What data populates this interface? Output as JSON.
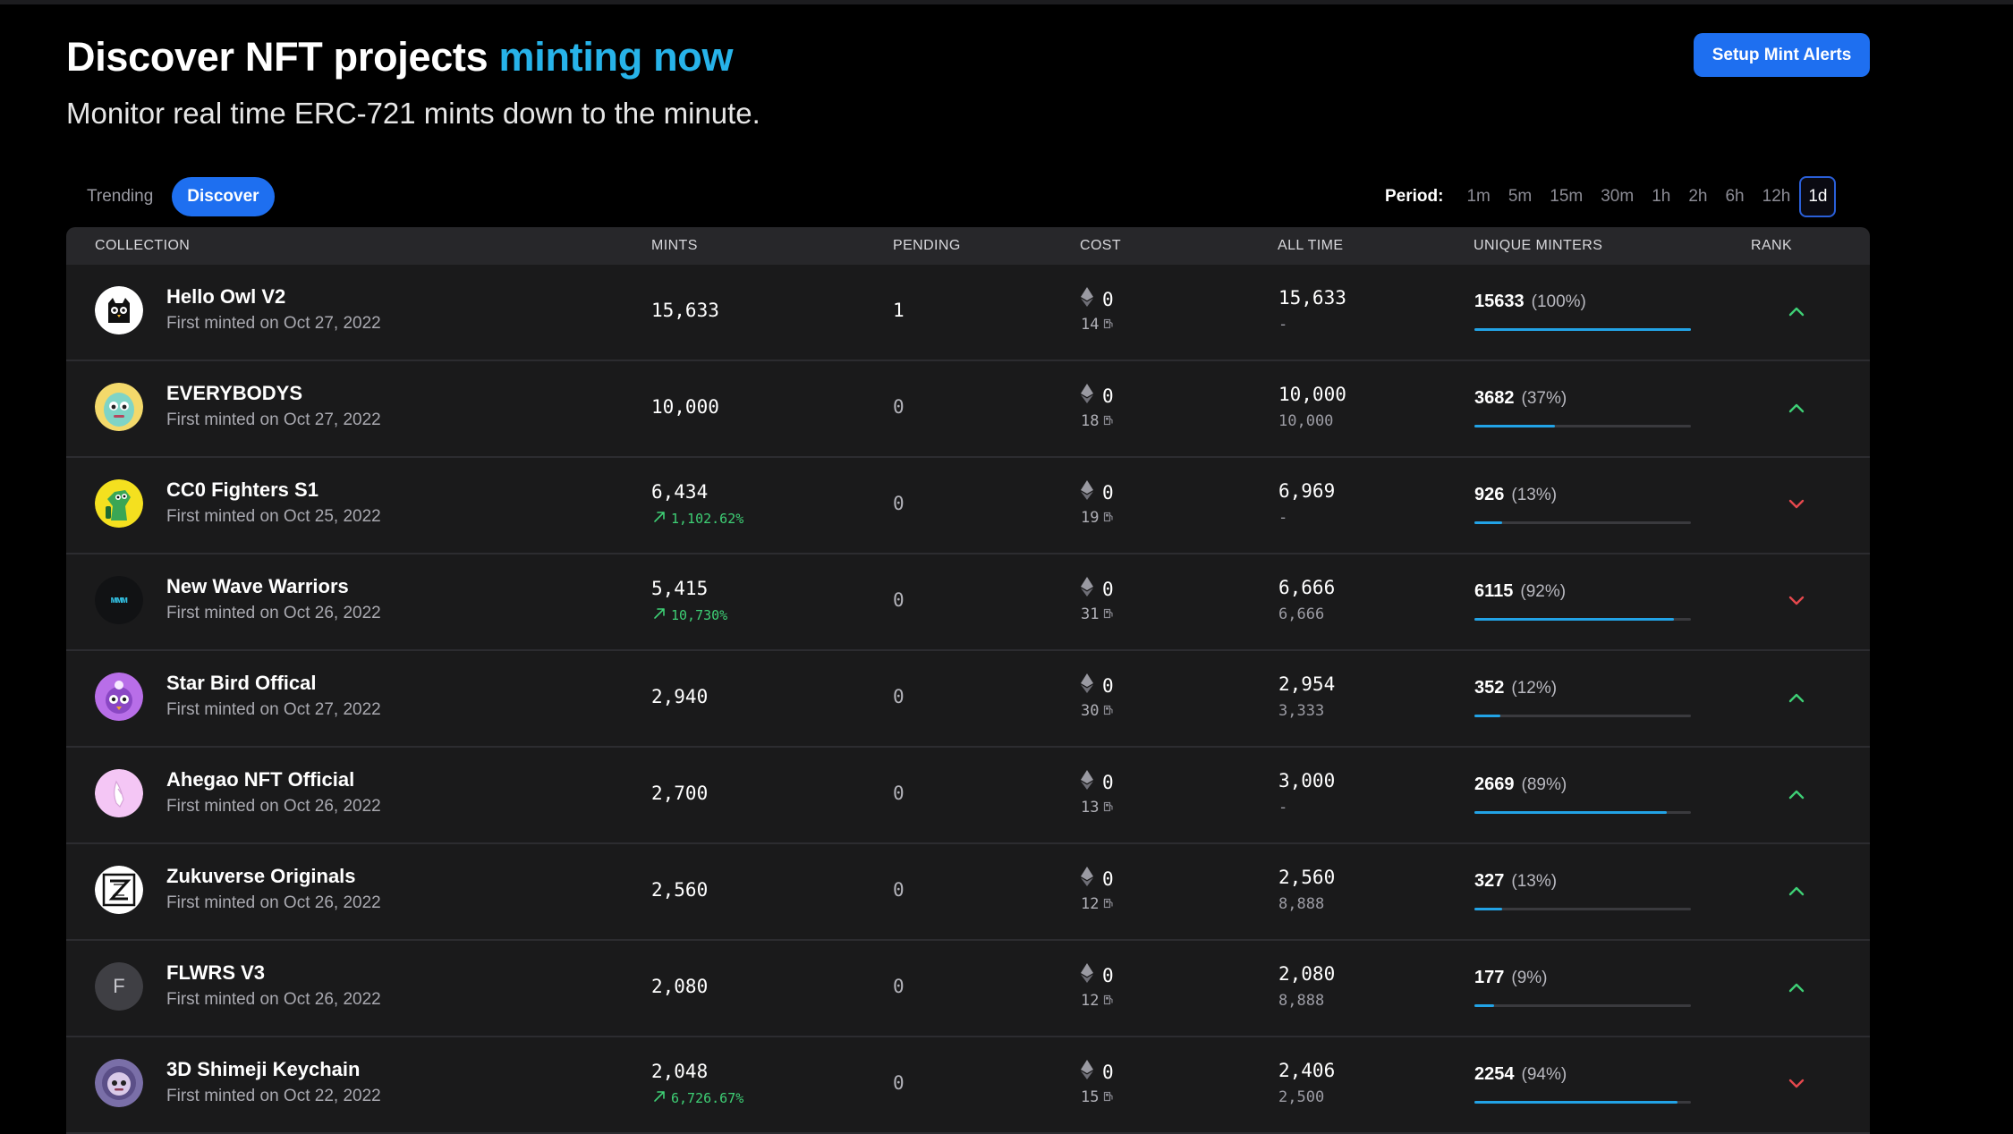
{
  "header": {
    "title_main": "Discover NFT projects",
    "title_accent": "minting now",
    "subtitle": "Monitor real time ERC-721 mints down to the minute.",
    "alert_button": "Setup Mint Alerts"
  },
  "tabs": [
    {
      "label": "Trending",
      "active": false
    },
    {
      "label": "Discover",
      "active": true
    }
  ],
  "period": {
    "label": "Period:",
    "options": [
      "1m",
      "5m",
      "15m",
      "30m",
      "1h",
      "2h",
      "6h",
      "12h",
      "1d"
    ],
    "selected": "1d"
  },
  "columns": {
    "collection": "COLLECTION",
    "mints": "MINTS",
    "pending": "PENDING",
    "cost": "COST",
    "all_time": "ALL TIME",
    "unique_minters": "UNIQUE MINTERS",
    "rank": "RANK"
  },
  "colors": {
    "accent": "#27b3e9",
    "button": "#1e6ff0",
    "up": "#3ecf75",
    "down": "#e5484d",
    "bar": "#22a3e6"
  },
  "rows": [
    {
      "name": "Hello Owl V2",
      "date": "First minted on Oct 27, 2022",
      "mints": "15,633",
      "growth": "",
      "pending": "1",
      "cost": "0",
      "gas": "14",
      "all_time": "15,633",
      "supply": "-",
      "unique": "15633",
      "unique_pct": "(100%)",
      "unique_fraction": 1.0,
      "rank": "up",
      "avatar": "owl-avatar"
    },
    {
      "name": "EVERYBODYS",
      "date": "First minted on Oct 27, 2022",
      "mints": "10,000",
      "growth": "",
      "pending": "0",
      "cost": "0",
      "gas": "18",
      "all_time": "10,000",
      "supply": "10,000",
      "unique": "3682",
      "unique_pct": "(37%)",
      "unique_fraction": 0.37,
      "rank": "up",
      "avatar": "everybodys-avatar"
    },
    {
      "name": "CC0 Fighters S1",
      "date": "First minted on Oct 25, 2022",
      "mints": "6,434",
      "growth": "1,102.62%",
      "pending": "0",
      "cost": "0",
      "gas": "19",
      "all_time": "6,969",
      "supply": "-",
      "unique": "926",
      "unique_pct": "(13%)",
      "unique_fraction": 0.13,
      "rank": "down",
      "avatar": "fighter-avatar"
    },
    {
      "name": "New Wave Warriors",
      "date": "First minted on Oct 26, 2022",
      "mints": "5,415",
      "growth": "10,730%",
      "pending": "0",
      "cost": "0",
      "gas": "31",
      "all_time": "6,666",
      "supply": "6,666",
      "unique": "6115",
      "unique_pct": "(92%)",
      "unique_fraction": 0.92,
      "rank": "down",
      "avatar": "warriors-avatar",
      "avatar_text": "ММM"
    },
    {
      "name": "Star Bird Offical",
      "date": "First minted on Oct 27, 2022",
      "mints": "2,940",
      "growth": "",
      "pending": "0",
      "cost": "0",
      "gas": "30",
      "all_time": "2,954",
      "supply": "3,333",
      "unique": "352",
      "unique_pct": "(12%)",
      "unique_fraction": 0.12,
      "rank": "up",
      "avatar": "starbird-avatar"
    },
    {
      "name": "Ahegao NFT Official",
      "date": "First minted on Oct 26, 2022",
      "mints": "2,700",
      "growth": "",
      "pending": "0",
      "cost": "0",
      "gas": "13",
      "all_time": "3,000",
      "supply": "-",
      "unique": "2669",
      "unique_pct": "(89%)",
      "unique_fraction": 0.89,
      "rank": "up",
      "avatar": "ahegao-avatar"
    },
    {
      "name": "Zukuverse Originals",
      "date": "First minted on Oct 26, 2022",
      "mints": "2,560",
      "growth": "",
      "pending": "0",
      "cost": "0",
      "gas": "12",
      "all_time": "2,560",
      "supply": "8,888",
      "unique": "327",
      "unique_pct": "(13%)",
      "unique_fraction": 0.13,
      "rank": "up",
      "avatar": "zukuverse-avatar",
      "avatar_text": "Z"
    },
    {
      "name": "FLWRS V3",
      "date": "First minted on Oct 26, 2022",
      "mints": "2,080",
      "growth": "",
      "pending": "0",
      "cost": "0",
      "gas": "12",
      "all_time": "2,080",
      "supply": "8,888",
      "unique": "177",
      "unique_pct": "(9%)",
      "unique_fraction": 0.09,
      "rank": "up",
      "avatar": "flwrs-avatar",
      "avatar_text": "F"
    },
    {
      "name": "3D Shimeji Keychain",
      "date": "First minted on Oct 22, 2022",
      "mints": "2,048",
      "growth": "6,726.67%",
      "pending": "0",
      "cost": "0",
      "gas": "15",
      "all_time": "2,406",
      "supply": "2,500",
      "unique": "2254",
      "unique_pct": "(94%)",
      "unique_fraction": 0.94,
      "rank": "down",
      "avatar": "shimeji-avatar"
    }
  ]
}
